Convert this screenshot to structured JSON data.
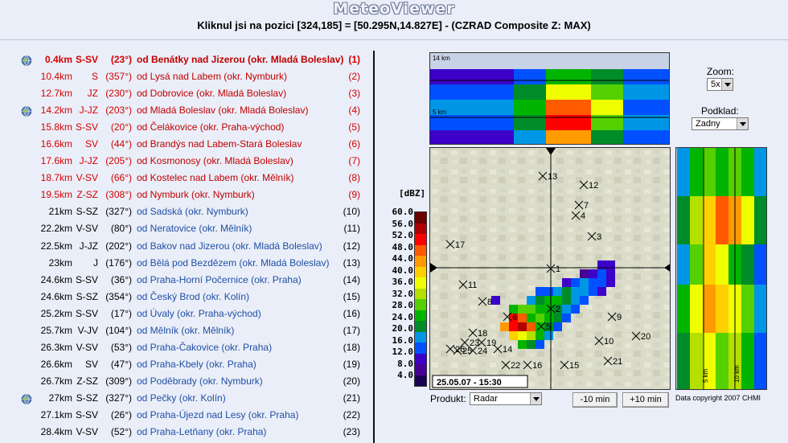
{
  "app_title": "MeteoViewer",
  "headline": "Kliknul jsi na pozici [324,185] = [50.295N,14.827E] - (CZRAD Composite Z: MAX)",
  "places": [
    {
      "dist": "0.4km",
      "dir": "S-SV",
      "deg": "(23°)",
      "name": "od Benátky nad Jizerou (okr. Mladá Boleslav)",
      "idx": "(1)",
      "style": "red",
      "globe": true
    },
    {
      "dist": "10.4km",
      "dir": "S",
      "deg": "(357°)",
      "name": "od Lysá nad Labem (okr. Nymburk)",
      "idx": "(2)",
      "style": "red",
      "globe": false
    },
    {
      "dist": "12.7km",
      "dir": "JZ",
      "deg": "(230°)",
      "name": "od Dobrovice (okr. Mladá Boleslav)",
      "idx": "(3)",
      "style": "red",
      "globe": false
    },
    {
      "dist": "14.2km",
      "dir": "J-JZ",
      "deg": "(203°)",
      "name": "od Mladá Boleslav (okr. Mladá Boleslav)",
      "idx": "(4)",
      "style": "red",
      "globe": true
    },
    {
      "dist": "15.8km",
      "dir": "S-SV",
      "deg": "(20°)",
      "name": "od Čelákovice (okr. Praha-východ)",
      "idx": "(5)",
      "style": "red",
      "globe": false
    },
    {
      "dist": "16.6km",
      "dir": "SV",
      "deg": "(44°)",
      "name": "od Brandýs nad Labem-Stará Boleslav",
      "idx": "(6)",
      "style": "red",
      "globe": false
    },
    {
      "dist": "17.6km",
      "dir": "J-JZ",
      "deg": "(205°)",
      "name": "od Kosmonosy (okr. Mladá Boleslav)",
      "idx": "(7)",
      "style": "red",
      "globe": false
    },
    {
      "dist": "18.7km",
      "dir": "V-SV",
      "deg": "(66°)",
      "name": "od Kostelec nad Labem (okr. Mělník)",
      "idx": "(8)",
      "style": "red",
      "globe": false
    },
    {
      "dist": "19.5km",
      "dir": "Z-SZ",
      "deg": "(308°)",
      "name": "od Nymburk (okr. Nymburk)",
      "idx": "(9)",
      "style": "red",
      "globe": false
    },
    {
      "dist": "21km",
      "dir": "S-SZ",
      "deg": "(327°)",
      "name": "od Sadská (okr. Nymburk)",
      "idx": "(10)",
      "style": "blue",
      "globe": false
    },
    {
      "dist": "22.2km",
      "dir": "V-SV",
      "deg": "(80°)",
      "name": "od Neratovice (okr. Mělník)",
      "idx": "(11)",
      "style": "blue",
      "globe": false
    },
    {
      "dist": "22.5km",
      "dir": "J-JZ",
      "deg": "(202°)",
      "name": "od Bakov nad Jizerou (okr. Mladá Boleslav)",
      "idx": "(12)",
      "style": "blue",
      "globe": false
    },
    {
      "dist": "23km",
      "dir": "J",
      "deg": "(176°)",
      "name": "od Bělá pod Bezdězem (okr. Mladá Boleslav)",
      "idx": "(13)",
      "style": "blue",
      "globe": false
    },
    {
      "dist": "24.6km",
      "dir": "S-SV",
      "deg": "(36°)",
      "name": "od Praha-Horní Počernice (okr. Praha)",
      "idx": "(14)",
      "style": "blue",
      "globe": false
    },
    {
      "dist": "24.6km",
      "dir": "S-SZ",
      "deg": "(354°)",
      "name": "od Český Brod (okr. Kolín)",
      "idx": "(15)",
      "style": "blue",
      "globe": false
    },
    {
      "dist": "25.2km",
      "dir": "S-SV",
      "deg": "(17°)",
      "name": "od Úvaly (okr. Praha-východ)",
      "idx": "(16)",
      "style": "blue",
      "globe": false
    },
    {
      "dist": "25.7km",
      "dir": "V-JV",
      "deg": "(104°)",
      "name": "od Mělník (okr. Mělník)",
      "idx": "(17)",
      "style": "blue",
      "globe": false
    },
    {
      "dist": "26.3km",
      "dir": "V-SV",
      "deg": "(53°)",
      "name": "od Praha-Čakovice (okr. Praha)",
      "idx": "(18)",
      "style": "blue",
      "globe": false
    },
    {
      "dist": "26.6km",
      "dir": "SV",
      "deg": "(47°)",
      "name": "od Praha-Kbely (okr. Praha)",
      "idx": "(19)",
      "style": "blue",
      "globe": false
    },
    {
      "dist": "26.7km",
      "dir": "Z-SZ",
      "deg": "(309°)",
      "name": "od Poděbrady (okr. Nymburk)",
      "idx": "(20)",
      "style": "blue",
      "globe": false
    },
    {
      "dist": "27km",
      "dir": "S-SZ",
      "deg": "(327°)",
      "name": "od Pečky (okr. Kolín)",
      "idx": "(21)",
      "style": "blue",
      "globe": true
    },
    {
      "dist": "27.1km",
      "dir": "S-SV",
      "deg": "(26°)",
      "name": "od Praha-Újezd nad Lesy (okr. Praha)",
      "idx": "(22)",
      "style": "blue",
      "globe": false
    },
    {
      "dist": "28.4km",
      "dir": "V-SV",
      "deg": "(52°)",
      "name": "od Praha-Letňany (okr. Praha)",
      "idx": "(23)",
      "style": "blue",
      "globe": false
    }
  ],
  "legend": {
    "title": "[dBZ]",
    "labels": [
      "60.0",
      "56.0",
      "52.0",
      "48.0",
      "44.0",
      "40.0",
      "36.0",
      "32.0",
      "28.0",
      "24.0",
      "20.0",
      "16.0",
      "12.0",
      "8.0",
      "4.0"
    ],
    "colors": [
      "#6a0000",
      "#b00000",
      "#ff0000",
      "#ff5a00",
      "#ff9a00",
      "#ffd000",
      "#f0ff00",
      "#b4e000",
      "#55d000",
      "#00b400",
      "#008c28",
      "#0096e6",
      "#0050ff",
      "#3c00c8",
      "#460096",
      "#1a0050"
    ]
  },
  "map": {
    "timestamp": "25.05.07 - 15:30",
    "markers": [
      "1",
      "2",
      "3",
      "4",
      "5",
      "6",
      "7",
      "8",
      "9",
      "10",
      "11",
      "12",
      "13",
      "14",
      "15",
      "16",
      "17",
      "18",
      "19",
      "20",
      "21",
      "22",
      "23",
      "24",
      "25",
      "26"
    ]
  },
  "top_section": {
    "label_top": "14 km",
    "label_mid": "5 km"
  },
  "side_section": {
    "label_a": "5 km",
    "label_b": "10 km"
  },
  "controls": {
    "zoom_label": "Zoom:",
    "zoom_value": "5x",
    "podklad_label": "Podklad:",
    "podklad_value": "Zadny",
    "produkt_label": "Produkt:",
    "produkt_value": "Radar",
    "minus_button": "-10 min",
    "plus_button": "+10 min"
  },
  "copyright": "Data copyright 2007 CHMI"
}
